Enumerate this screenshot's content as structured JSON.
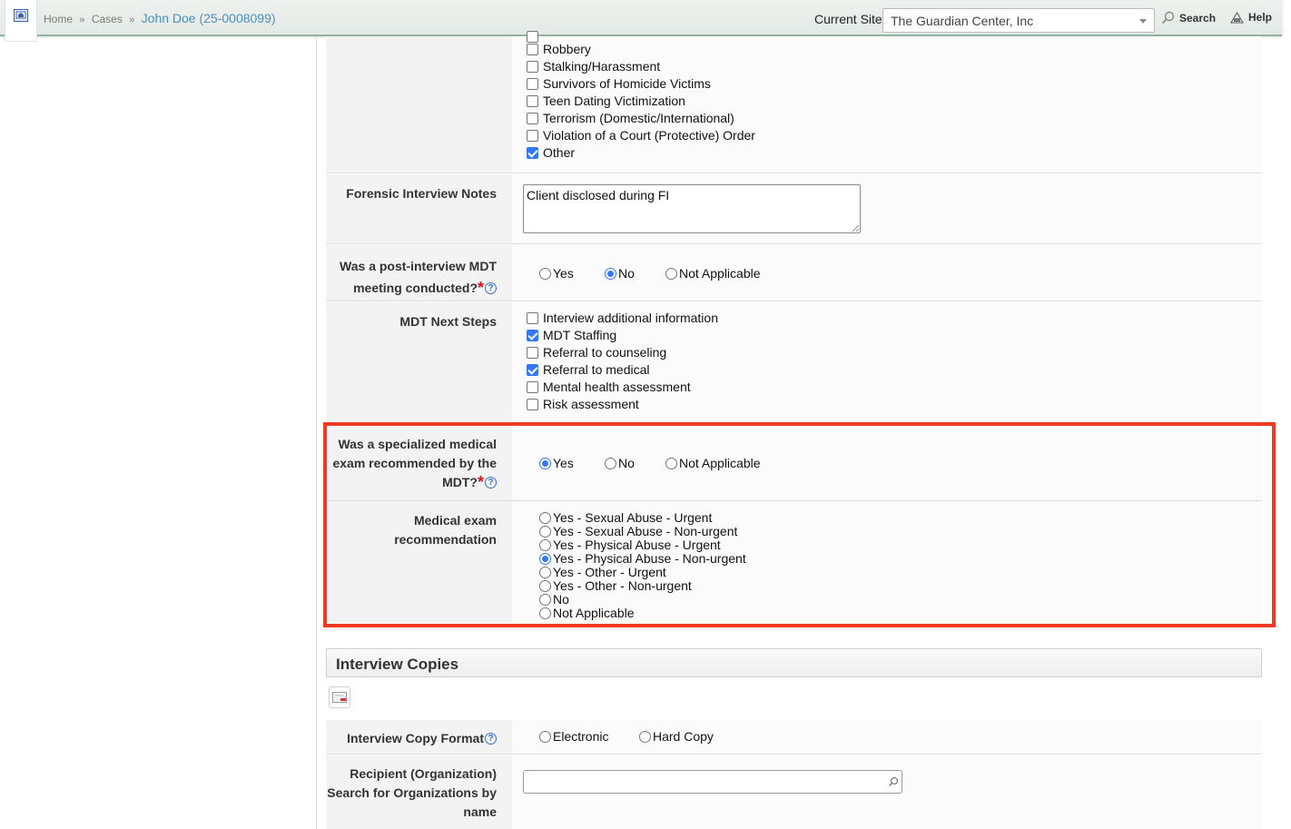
{
  "header": {
    "breadcrumb": {
      "home": "Home",
      "cases": "Cases",
      "separator": "»",
      "current": "John Doe (25-0008099)"
    },
    "current_site_label": "Current Site",
    "current_site_value": "The Guardian Center, Inc",
    "search_label": "Search",
    "help_label": "Help"
  },
  "victimization_options": [
    {
      "label": "Robbery",
      "checked": false
    },
    {
      "label": "Stalking/Harassment",
      "checked": false
    },
    {
      "label": "Survivors of Homicide Victims",
      "checked": false
    },
    {
      "label": "Teen Dating Victimization",
      "checked": false
    },
    {
      "label": "Terrorism (Domestic/International)",
      "checked": false
    },
    {
      "label": "Violation of a Court (Protective) Order",
      "checked": false
    },
    {
      "label": "Other",
      "checked": true
    }
  ],
  "forensic_notes": {
    "label": "Forensic Interview Notes",
    "value": "Client disclosed during FI"
  },
  "post_interview_mdt": {
    "label_line1": "Was a post-interview MDT",
    "label_line2": "meeting conducted?",
    "required_mark": "*",
    "help_mark": "?",
    "options": [
      {
        "label": "Yes",
        "checked": false
      },
      {
        "label": "No",
        "checked": true
      },
      {
        "label": "Not Applicable",
        "checked": false
      }
    ]
  },
  "mdt_next_steps": {
    "label": "MDT Next Steps",
    "options": [
      {
        "label": "Interview additional information",
        "checked": false
      },
      {
        "label": "MDT Staffing",
        "checked": true
      },
      {
        "label": "Referral to counseling",
        "checked": false
      },
      {
        "label": "Referral to medical",
        "checked": true
      },
      {
        "label": "Mental health assessment",
        "checked": false
      },
      {
        "label": "Risk assessment",
        "checked": false
      }
    ]
  },
  "specialized_exam": {
    "label_line1": "Was a specialized medical",
    "label_line2": "exam recommended by the",
    "label_line3": "MDT?",
    "required_mark": "*",
    "help_mark": "?",
    "options": [
      {
        "label": "Yes",
        "checked": true
      },
      {
        "label": "No",
        "checked": false
      },
      {
        "label": "Not Applicable",
        "checked": false
      }
    ]
  },
  "medical_exam_recommendation": {
    "label_line1": "Medical exam",
    "label_line2": "recommendation",
    "options": [
      {
        "label": "Yes - Sexual Abuse - Urgent",
        "checked": false
      },
      {
        "label": "Yes - Sexual Abuse - Non-urgent",
        "checked": false
      },
      {
        "label": "Yes - Physical Abuse - Urgent",
        "checked": false
      },
      {
        "label": "Yes - Physical Abuse - Non-urgent",
        "checked": true
      },
      {
        "label": "Yes - Other - Urgent",
        "checked": false
      },
      {
        "label": "Yes - Other - Non-urgent",
        "checked": false
      },
      {
        "label": "No",
        "checked": false
      },
      {
        "label": "Not Applicable",
        "checked": false
      }
    ]
  },
  "interview_copies": {
    "section_title": "Interview Copies",
    "format_label": "Interview Copy Format",
    "help_mark": "?",
    "format_options": [
      {
        "label": "Electronic",
        "checked": false
      },
      {
        "label": "Hard Copy",
        "checked": false
      }
    ],
    "recipient_label_line1": "Recipient (Organization)",
    "recipient_label_line2": "Search for Organizations by",
    "recipient_label_line3": "name",
    "recipient_value": ""
  },
  "colors": {
    "accent": "#3478f6",
    "highlight": "#f03a24",
    "required": "#dd1111",
    "link": "#4a8fc4"
  },
  "icons": {
    "home": "home-icon",
    "dropdown": "chevron-down-icon",
    "search": "magnifier-icon",
    "help": "help-icon",
    "copy": "copy-icon"
  }
}
